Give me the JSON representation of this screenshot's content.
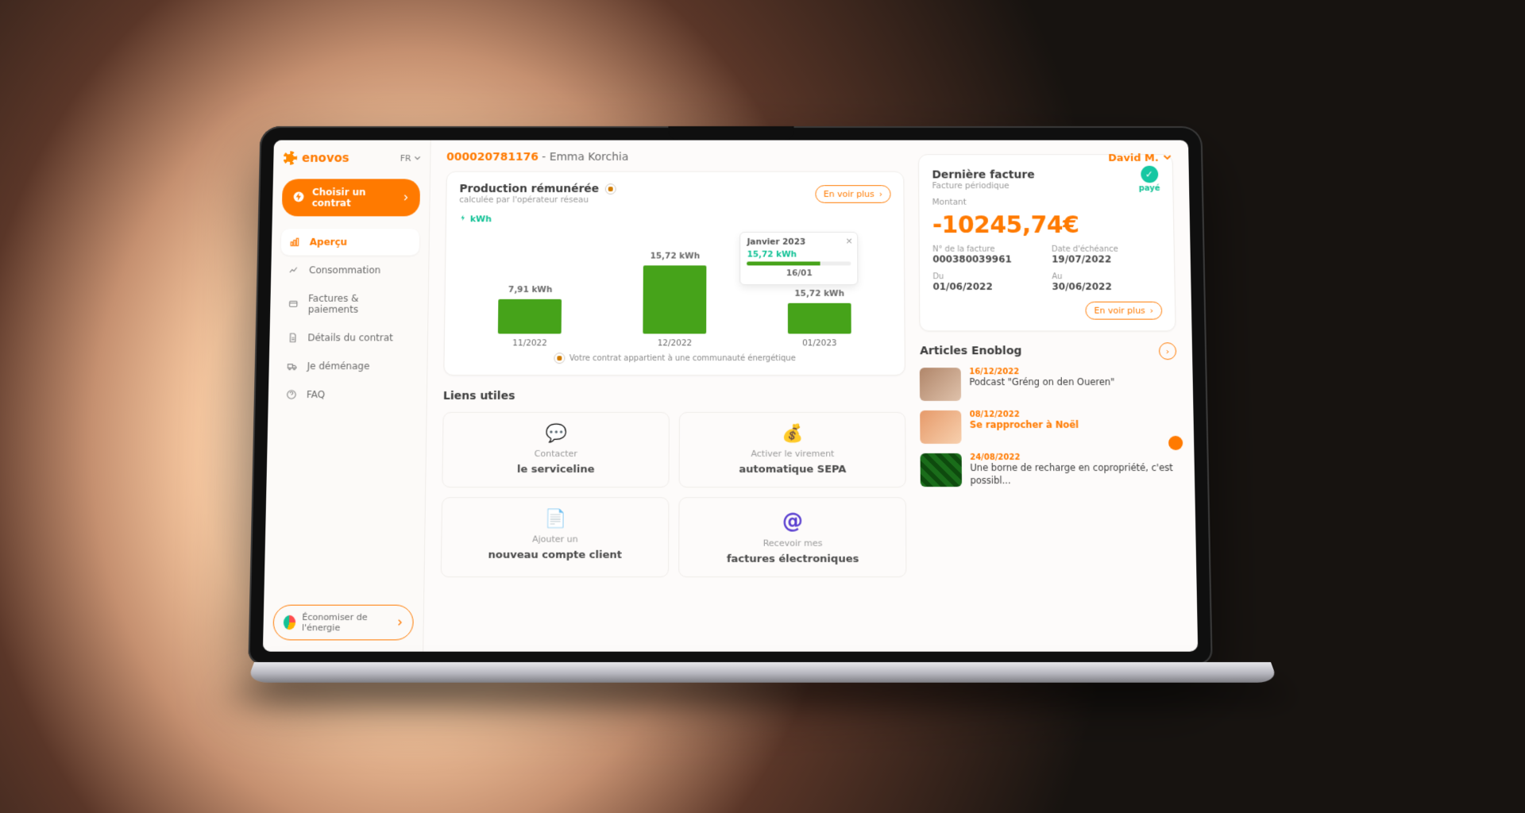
{
  "brand": {
    "name": "enovos",
    "lang": "FR"
  },
  "user": {
    "display": "David M."
  },
  "account": {
    "number": "000020781176",
    "name": "Emma Korchia"
  },
  "sidebar": {
    "contract_button": "Choisir un contrat",
    "items": [
      {
        "label": "Aperçu"
      },
      {
        "label": "Consommation"
      },
      {
        "label": "Factures & paiements"
      },
      {
        "label": "Détails du contrat"
      },
      {
        "label": "Je déménage"
      },
      {
        "label": "FAQ"
      }
    ],
    "save_energy": "Économiser de l'énergie"
  },
  "production": {
    "title": "Production rémunérée",
    "subtitle": "calculée par l'opérateur réseau",
    "unit": "kWh",
    "see_more": "En voir plus",
    "community_note": "Votre contrat appartient à une communauté énergétique",
    "tooltip": {
      "title": "Janvier 2023",
      "value": "15,72 kWh",
      "date": "16/01",
      "progress_pct": 70
    }
  },
  "chart_data": {
    "type": "bar",
    "title": "Production rémunérée",
    "ylabel": "kWh",
    "yunit": "kWh",
    "ylim": [
      0,
      18
    ],
    "categories": [
      "11/2022",
      "12/2022",
      "01/2023"
    ],
    "values": [
      7.91,
      15.72,
      15.72
    ],
    "value_labels": [
      "7,91 kWh",
      "15,72 kWh",
      "15,72 kWh"
    ]
  },
  "links": {
    "title": "Liens utiles",
    "tiles": [
      {
        "line1": "Contacter",
        "line2": "le serviceline"
      },
      {
        "line1": "Activer le virement",
        "line2": "automatique SEPA"
      },
      {
        "line1": "Ajouter un",
        "line2": "nouveau compte client"
      },
      {
        "line1": "Recevoir mes",
        "line2": "factures électroniques"
      }
    ]
  },
  "invoice": {
    "title": "Dernière facture",
    "subtitle": "Facture périodique",
    "status": "payé",
    "amount_label": "Montant",
    "amount": "-10245,74€",
    "fields": {
      "number_label": "N° de la facture",
      "number": "000380039961",
      "due_label": "Date d'échéance",
      "due": "19/07/2022",
      "from_label": "Du",
      "from": "01/06/2022",
      "to_label": "Au",
      "to": "30/06/2022"
    },
    "see_more": "En voir plus"
  },
  "blog": {
    "title": "Articles Enoblog",
    "posts": [
      {
        "date": "16/12/2022",
        "title": "Podcast \"Gréng on den Oueren\"",
        "highlight": false
      },
      {
        "date": "08/12/2022",
        "title": "Se rapprocher à Noël",
        "highlight": true
      },
      {
        "date": "24/08/2022",
        "title": "Une borne de recharge en copropriété, c'est possibl...",
        "highlight": false
      }
    ]
  }
}
